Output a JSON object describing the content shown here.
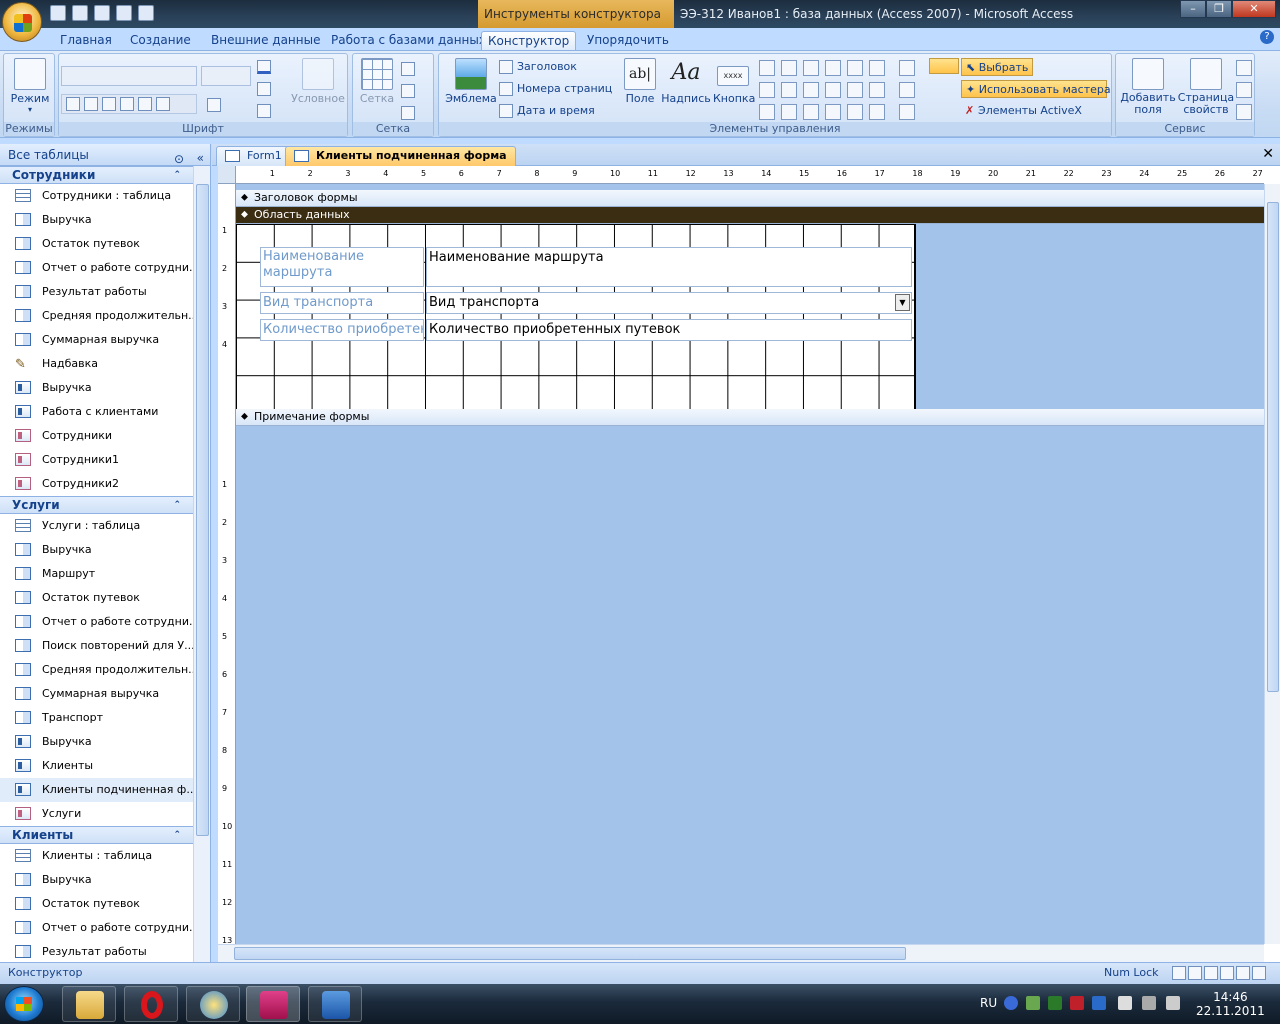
{
  "titlebar": {
    "context_tab": "Инструменты конструктора форм",
    "title": "ЭЭ-312 Иванов1 : база данных (Access 2007) - Microsoft Access"
  },
  "ribbon_tabs": [
    "Главная",
    "Создание",
    "Внешние данные",
    "Работа с базами данных",
    "Конструктор",
    "Упорядочить"
  ],
  "ribbon": {
    "views": {
      "label": "Режим",
      "group": "Режимы"
    },
    "font": {
      "group": "Шрифт",
      "conditional": "Условное"
    },
    "gridlines": {
      "label": "Сетка",
      "group": "Сетка"
    },
    "controls": {
      "group": "Элементы управления",
      "logo": "Эмблема",
      "title": "Заголовок",
      "page_numbers": "Номера страниц",
      "date_time": "Дата и время",
      "field": "Поле",
      "label": "Надпись",
      "button": "Кнопка",
      "select": "Выбрать",
      "use_wizards": "Использовать мастера",
      "activex": "Элементы ActiveX"
    },
    "tools": {
      "group": "Сервис",
      "add_fields": "Добавить поля",
      "property_sheet": "Страница свойств"
    }
  },
  "nav": {
    "header": "Все таблицы",
    "groups": [
      {
        "name": "Сотрудники",
        "items": [
          {
            "label": "Сотрудники : таблица",
            "icon": "table"
          },
          {
            "label": "Выручка",
            "icon": "query"
          },
          {
            "label": "Остаток путевок",
            "icon": "query"
          },
          {
            "label": "Отчет о работе сотрудни...",
            "icon": "query"
          },
          {
            "label": "Результат работы",
            "icon": "query"
          },
          {
            "label": "Средняя продолжительн...",
            "icon": "query"
          },
          {
            "label": "Суммарная выручка",
            "icon": "query"
          },
          {
            "label": "Надбавка",
            "icon": "macro"
          },
          {
            "label": "Выручка",
            "icon": "form"
          },
          {
            "label": "Работа с клиентами",
            "icon": "form"
          },
          {
            "label": "Сотрудники",
            "icon": "report"
          },
          {
            "label": "Сотрудники1",
            "icon": "report"
          },
          {
            "label": "Сотрудники2",
            "icon": "report"
          }
        ]
      },
      {
        "name": "Услуги",
        "items": [
          {
            "label": "Услуги : таблица",
            "icon": "table"
          },
          {
            "label": "Выручка",
            "icon": "query"
          },
          {
            "label": "Маршрут",
            "icon": "query"
          },
          {
            "label": "Остаток путевок",
            "icon": "query"
          },
          {
            "label": "Отчет о работе сотрудни...",
            "icon": "query"
          },
          {
            "label": "Поиск повторений для У...",
            "icon": "query"
          },
          {
            "label": "Средняя продолжительн...",
            "icon": "query"
          },
          {
            "label": "Суммарная выручка",
            "icon": "query"
          },
          {
            "label": "Транспорт",
            "icon": "query"
          },
          {
            "label": "Выручка",
            "icon": "form"
          },
          {
            "label": "Клиенты",
            "icon": "form"
          },
          {
            "label": "Клиенты подчиненная ф...",
            "icon": "form",
            "selected": true
          },
          {
            "label": "Услуги",
            "icon": "report"
          }
        ]
      },
      {
        "name": "Клиенты",
        "items": [
          {
            "label": "Клиенты : таблица",
            "icon": "table"
          },
          {
            "label": "Выручка",
            "icon": "query"
          },
          {
            "label": "Остаток путевок",
            "icon": "query"
          },
          {
            "label": "Отчет о работе сотрудни...",
            "icon": "query"
          },
          {
            "label": "Результат работы",
            "icon": "query"
          }
        ]
      }
    ]
  },
  "doc_tabs": [
    {
      "label": "Form1",
      "active": false
    },
    {
      "label": "Клиенты подчиненная форма",
      "active": true
    }
  ],
  "design": {
    "sections": {
      "header": "Заголовок формы",
      "detail": "Область данных",
      "footer": "Примечание формы"
    },
    "ruler_top": [
      "1",
      "2",
      "3",
      "4",
      "5",
      "6",
      "7",
      "8",
      "9",
      "10",
      "11",
      "12",
      "13",
      "14",
      "15",
      "16",
      "17",
      "18",
      "19",
      "20",
      "21",
      "22",
      "23",
      "24",
      "25",
      "26",
      "27"
    ],
    "ruler_left": [
      "1",
      "2",
      "3",
      "4",
      "1",
      "2",
      "3",
      "4",
      "5",
      "6",
      "7",
      "8",
      "9",
      "10",
      "11",
      "12",
      "13"
    ],
    "controls": [
      {
        "label": "Наименование маршрута",
        "field": "Наименование маршрута"
      },
      {
        "label": "Вид транспорта",
        "field": "Вид транспорта"
      },
      {
        "label": "Количество приобретенн",
        "field": "Количество приобретенных путевок"
      }
    ]
  },
  "status": {
    "mode": "Конструктор",
    "numlock": "Num Lock"
  },
  "taskbar": {
    "lang": "RU",
    "time": "14:46",
    "date": "22.11.2011"
  }
}
